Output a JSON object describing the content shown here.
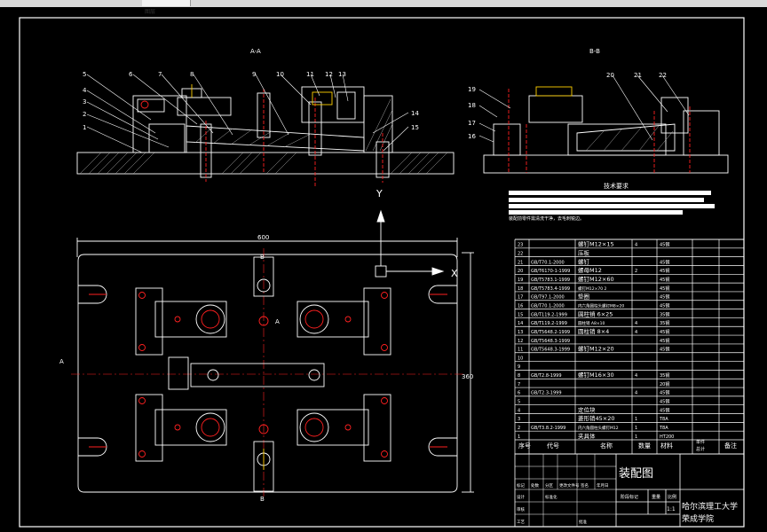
{
  "toolbar": {
    "tab_label": "图层"
  },
  "views": {
    "section_aa": "A-A",
    "section_bb": "B-B",
    "plan_dim_width": "600",
    "plan_dim_height": "360",
    "axis_y": "Y",
    "axis_x": "X",
    "mark_a_left": "A",
    "mark_a_right": "A",
    "mark_b_top": "B",
    "mark_b_bottom": "B"
  },
  "callouts_aa": [
    "1",
    "2",
    "3",
    "4",
    "5",
    "6",
    "7",
    "8",
    "9",
    "10",
    "11",
    "12",
    "13",
    "14",
    "15"
  ],
  "callouts_bb": [
    "16",
    "17",
    "18",
    "19",
    "20",
    "21",
    "22"
  ],
  "tech_req": {
    "title": "技术要求",
    "note": "装配前零件需清洗干净，去毛刺锐边。"
  },
  "bom": {
    "header": {
      "seq": "序号",
      "code": "代号",
      "name": "名称",
      "qty": "数量",
      "material": "材料",
      "unit_weight": "单件",
      "total_weight": "总计",
      "remarks": "备注",
      "weight": "重量"
    },
    "rows": [
      {
        "seq": "23",
        "code": "",
        "name": "螺钉M12×15",
        "qty": "4",
        "material": "45钢"
      },
      {
        "seq": "22",
        "code": "",
        "name": "压板",
        "qty": "",
        "material": ""
      },
      {
        "seq": "21",
        "code": "GB/T70.1-2000",
        "name": "螺钉",
        "qty": "",
        "material": "45钢"
      },
      {
        "seq": "20",
        "code": "GB/T6170-1-1999",
        "name": "螺母M12",
        "qty": "2",
        "material": "45钢"
      },
      {
        "seq": "19",
        "code": "GB/T5783.1-1999",
        "name": "螺钉M12×60",
        "qty": "",
        "material": "45钢"
      },
      {
        "seq": "18",
        "code": "GB/T5783.4-1999",
        "name": "螺钉M12×70 2",
        "qty": "",
        "material": "45钢"
      },
      {
        "seq": "17",
        "code": "GB/T97.1-2000",
        "name": "垫圈",
        "qty": "",
        "material": "45钢"
      },
      {
        "seq": "16",
        "code": "GB/T70.1-2000",
        "name": "内六角圆柱头螺钉M8×20",
        "qty": "",
        "material": "45钢"
      },
      {
        "seq": "15",
        "code": "GB/T119.2-1999",
        "name": "圆柱销 6×25",
        "qty": "",
        "material": "35钢"
      },
      {
        "seq": "14",
        "code": "GB/T119.2-1999",
        "name": "圆柱销 A8×10",
        "qty": "4",
        "material": "35钢"
      },
      {
        "seq": "13",
        "code": "GB/T5648.2-1999",
        "name": "圆柱销 8×4",
        "qty": "4",
        "material": "45钢"
      },
      {
        "seq": "12",
        "code": "GB/T5648.3-1999",
        "name": "",
        "qty": "",
        "material": "45钢"
      },
      {
        "seq": "11",
        "code": "GB/T5648.3-1999",
        "name": "螺钉M12×20",
        "qty": "",
        "material": "45钢"
      },
      {
        "seq": "10",
        "code": "",
        "name": "",
        "qty": "",
        "material": ""
      },
      {
        "seq": "9",
        "code": "",
        "name": "",
        "qty": "",
        "material": ""
      },
      {
        "seq": "8",
        "code": "GB/T2.8-1999",
        "name": "螺钉M16×30",
        "qty": "4",
        "material": "35钢"
      },
      {
        "seq": "7",
        "code": "",
        "name": "",
        "qty": "",
        "material": "20钢"
      },
      {
        "seq": "6",
        "code": "GB/T2.3-1999",
        "name": "",
        "qty": "4",
        "material": "45钢"
      },
      {
        "seq": "5",
        "code": "",
        "name": "",
        "qty": "",
        "material": "45钢"
      },
      {
        "seq": "4",
        "code": "",
        "name": "定位块",
        "qty": "",
        "material": "45钢"
      },
      {
        "seq": "3",
        "code": "",
        "name": "菱形销45×20",
        "qty": "1",
        "material": "T8A"
      },
      {
        "seq": "2",
        "code": "GB/T3.8.2-1999",
        "name": "内六角圆柱头螺钉M12",
        "qty": "1",
        "material": "T8A"
      },
      {
        "seq": "1",
        "code": "",
        "name": "夹具体",
        "qty": "1",
        "material": "HT200"
      }
    ]
  },
  "title_block": {
    "drawing_name": "装配图",
    "school": "哈尔滨理工大学",
    "college": "荣成学院",
    "scale": "1:1",
    "stage_mark": "阶段标记",
    "weight": "重量",
    "ratio": "比例",
    "mark": "标记",
    "count": "处数",
    "zone": "分区",
    "change_doc": "更改文件号",
    "signature": "签名",
    "date": "年月日",
    "design": "设计",
    "standardize": "标准化",
    "review": "审核",
    "process": "工艺",
    "approve": "批准"
  },
  "colors": {
    "background": "#000000",
    "line_white": "#ffffff",
    "line_red": "#ff2020",
    "line_yellow": "#ffd000",
    "hatch": "#b0b0b0"
  }
}
